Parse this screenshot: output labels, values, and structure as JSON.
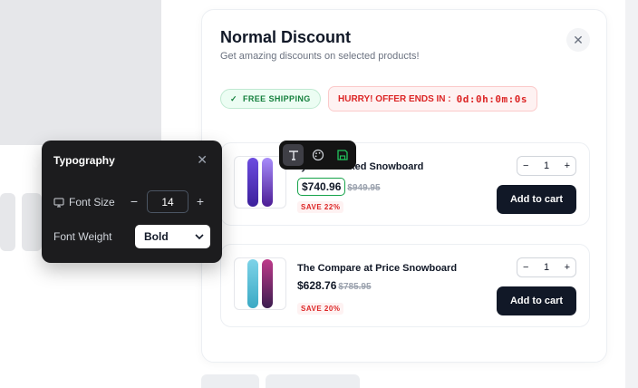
{
  "modal": {
    "title": "Normal Discount",
    "subtitle": "Get amazing discounts on selected products!",
    "close_icon": "close-icon",
    "free_shipping": "FREE SHIPPING",
    "timer_label": "HURRY! OFFER ENDS IN :",
    "timer_value": "0d:0h:0m:0s"
  },
  "products": [
    {
      "name": "ry Not Tracked Snowboard",
      "price": "$740.96",
      "compare_price": "$949.95",
      "save": "SAVE 22%",
      "quantity": "1",
      "cart_label": "Add to cart",
      "colors": [
        "#4f35c9",
        "#8b5cf6"
      ]
    },
    {
      "name": "The Compare at Price Snowboard",
      "price": "$628.76",
      "compare_price": "$785.95",
      "save": "SAVE 20%",
      "quantity": "1",
      "cart_label": "Add to cart",
      "colors": [
        "#60c6dc",
        "#6b2f6e"
      ]
    }
  ],
  "toolbar": {
    "buttons": [
      "text-icon",
      "palette-icon",
      "save-icon"
    ],
    "active": "text-icon"
  },
  "typography": {
    "title": "Typography",
    "font_size_label": "Font Size",
    "font_size_value": "14",
    "font_weight_label": "Font Weight",
    "font_weight_value": "Bold"
  },
  "colors": {
    "accent_dark": "#111827",
    "green": "#16a34a",
    "red": "#dc2626"
  }
}
